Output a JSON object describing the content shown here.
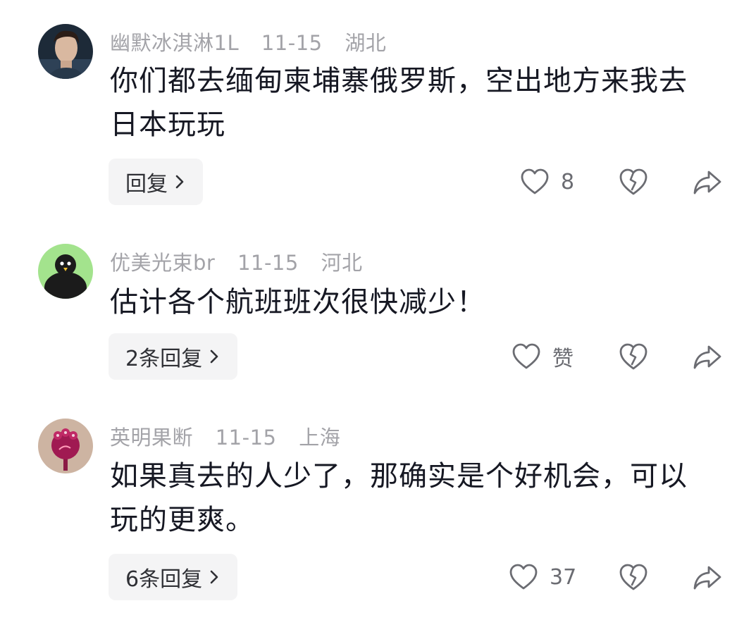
{
  "colors": {
    "meta_text": "#a3a3a8",
    "body_text": "#161823",
    "button_bg": "#f4f4f5",
    "icon_stroke": "#6b6c72"
  },
  "comments": [
    {
      "avatar": "person-photo-avatar",
      "username": "幽默冰淇淋1L",
      "date": "11-15",
      "location": "湖北",
      "text": "你们都去缅甸柬埔寨俄罗斯，空出地方来我去日本玩玩",
      "reply_label": "回复",
      "like_label": "8",
      "icons": [
        "heart-icon",
        "broken-heart-icon",
        "share-icon"
      ]
    },
    {
      "avatar": "black-bird-avatar",
      "username": "优美光束br",
      "date": "11-15",
      "location": "河北",
      "text": "估计各个航班班次很快减少！",
      "reply_label": "2条回复",
      "like_label": "赞",
      "icons": [
        "heart-icon",
        "broken-heart-icon",
        "share-icon"
      ]
    },
    {
      "avatar": "flower-avatar",
      "username": "英明果断",
      "date": "11-15",
      "location": "上海",
      "text": "如果真去的人少了，那确实是个好机会，可以玩的更爽。",
      "reply_label": "6条回复",
      "like_label": "37",
      "icons": [
        "heart-icon",
        "broken-heart-icon",
        "share-icon"
      ]
    }
  ]
}
